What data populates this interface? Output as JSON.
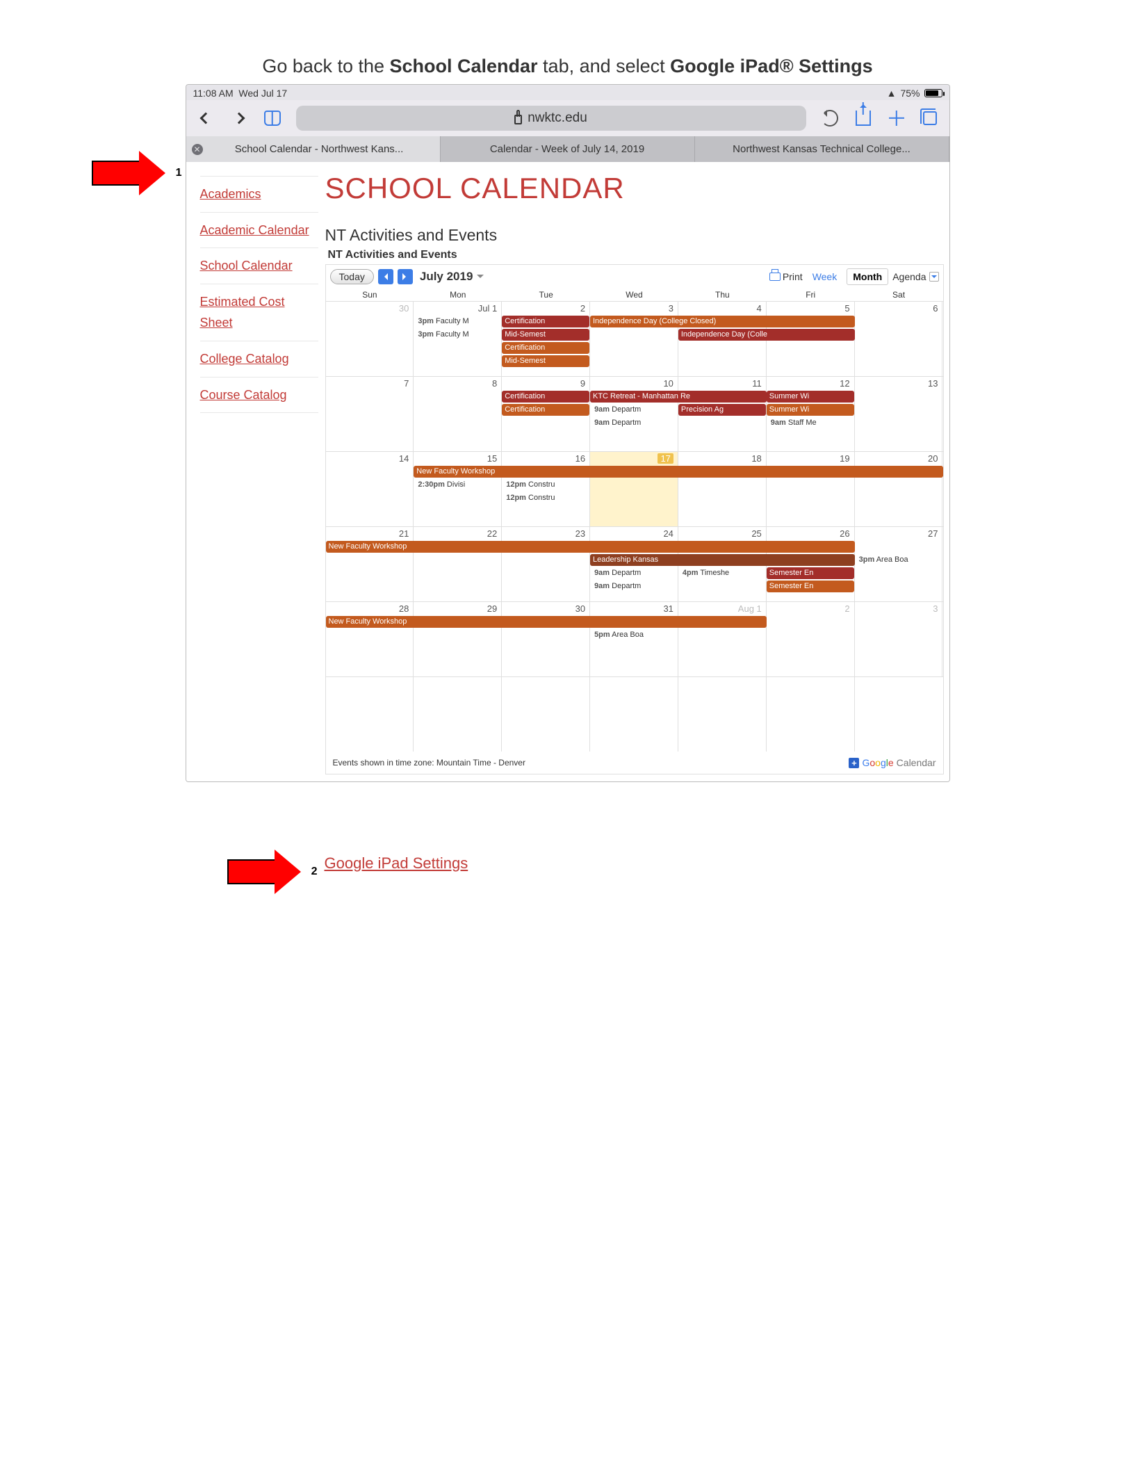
{
  "instruction": {
    "pre": "Go back to the ",
    "b1": "School Calendar",
    "mid": " tab, and select ",
    "b2": "Google iPad® Settings"
  },
  "status": {
    "time": "11:08 AM",
    "date": "Wed Jul 17",
    "battery": "75%"
  },
  "url": "nwktc.edu",
  "tabs": [
    {
      "label": "School Calendar - Northwest Kans...",
      "active": true
    },
    {
      "label": "Calendar - Week of July 14, 2019",
      "active": false
    },
    {
      "label": "Northwest Kansas Technical College...",
      "active": false
    }
  ],
  "sidenav": [
    "Academics",
    "Academic Calendar",
    "School Calendar",
    "Estimated Cost Sheet",
    "College Catalog",
    "Course Catalog"
  ],
  "pageTitle": "SCHOOL CALENDAR",
  "subheading": "NT Activities and Events",
  "embedTitle": "NT Activities and Events",
  "calToolbar": {
    "today": "Today",
    "month": "July 2019",
    "print": "Print",
    "week": "Week",
    "monthBtn": "Month",
    "agenda": "Agenda"
  },
  "dayNames": [
    "Sun",
    "Mon",
    "Tue",
    "Wed",
    "Thu",
    "Fri",
    "Sat"
  ],
  "dates": [
    [
      "30",
      "Jul 1",
      "2",
      "3",
      "4",
      "5",
      "6"
    ],
    [
      "7",
      "8",
      "9",
      "10",
      "11",
      "12",
      "13"
    ],
    [
      "14",
      "15",
      "16",
      "17",
      "18",
      "19",
      "20"
    ],
    [
      "21",
      "22",
      "23",
      "24",
      "25",
      "26",
      "27"
    ],
    [
      "28",
      "29",
      "30",
      "31",
      "Aug 1",
      "2",
      "3"
    ]
  ],
  "w1": {
    "m_e1": "3pm Faculty M",
    "m_e2": "3pm Faculty M",
    "t_e1": "Certification",
    "t_e2": "Mid-Semest",
    "t_e3": "Certification",
    "t_e4": "Mid-Semest",
    "span1": "Independence Day (College Closed)",
    "span2": "Independence Day (Colle"
  },
  "w2": {
    "t_e1": "Certification",
    "t_e2": "Certification",
    "w_span": "KTC Retreat - Manhattan Re",
    "w_e1": "9am Departm",
    "w_e2": "9am Departm",
    "th_e": "Precision Ag",
    "f_e1": "Summer Wi",
    "f_e2": "Summer Wi",
    "f_e3": "9am Staff Me"
  },
  "w3": {
    "span": "New Faculty Workshop",
    "m_e": "2:30pm Divisi",
    "t_e1": "12pm Constru",
    "t_e2": "12pm Constru"
  },
  "w4": {
    "span": "New Faculty Workshop",
    "w_e1": "Leadership Kansas",
    "w_e2": "9am Departm",
    "w_e3": "9am Departm",
    "th_e": "4pm Timeshe",
    "f_e1": "Semester En",
    "f_e2": "Semester En",
    "s_e": "3pm Area Boa"
  },
  "w5": {
    "span": "New Faculty Workshop",
    "w_e": "5pm Area Boa"
  },
  "calFooter": "Events shown in time zone: Mountain Time - Denver",
  "gcal": "Calendar",
  "arrows": {
    "n1": "1",
    "n2": "2"
  },
  "bottomLink": "Google iPad Settings"
}
